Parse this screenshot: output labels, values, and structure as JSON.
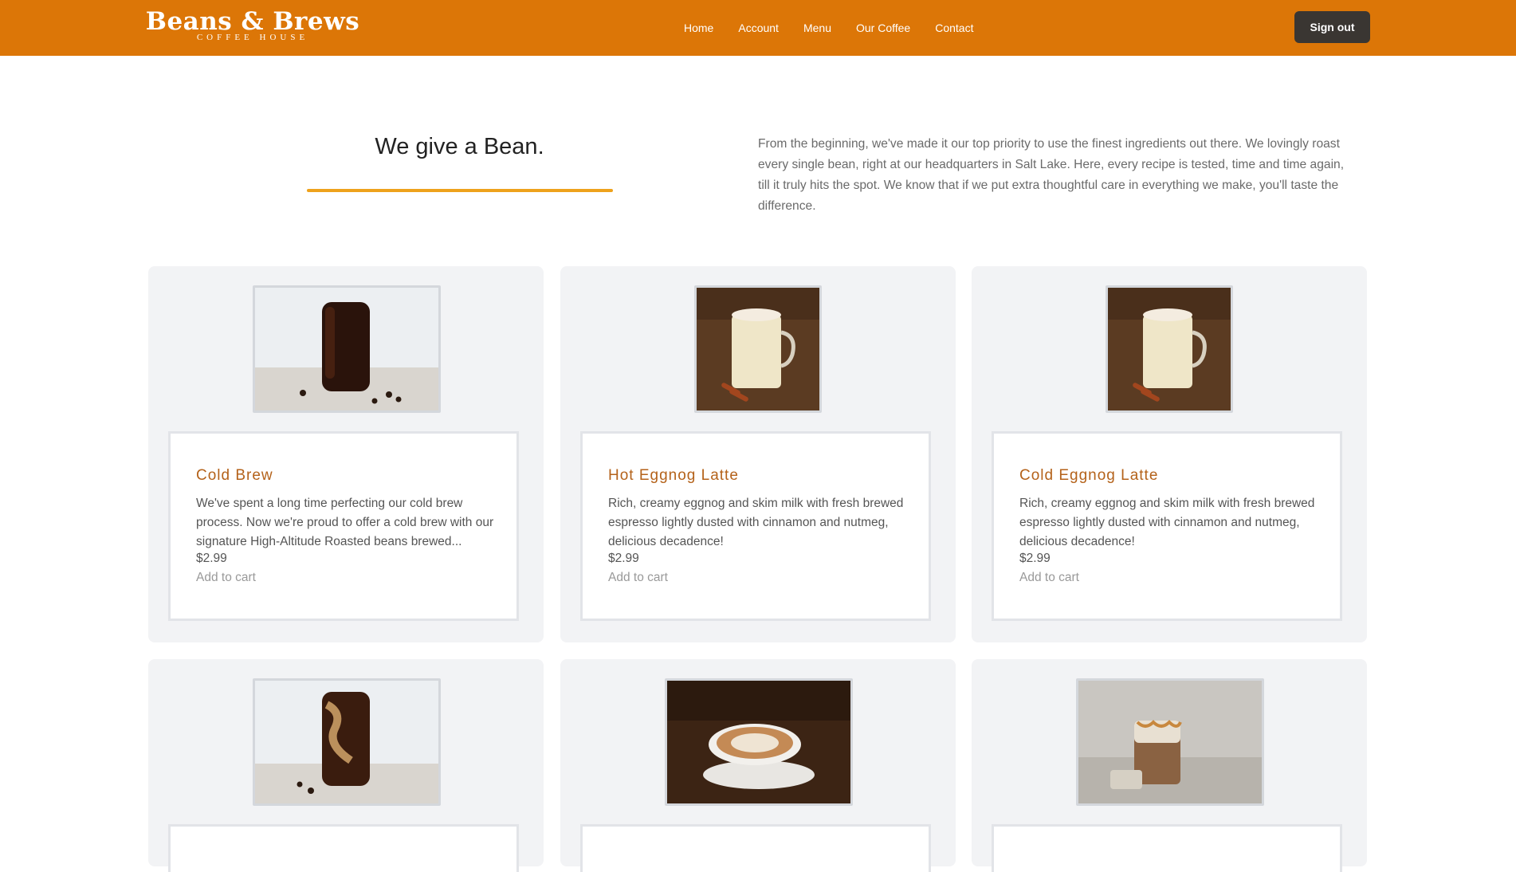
{
  "header": {
    "logo_main": "Beans & Brews",
    "logo_sub": "COFFEE HOUSE",
    "nav": [
      "Home",
      "Account",
      "Menu",
      "Our Coffee",
      "Contact"
    ],
    "signout_label": "Sign out",
    "bar_color": "#dc7607"
  },
  "intro": {
    "title": "We give a Bean.",
    "text": "From the beginning, we've made it our top priority to use the finest ingredients out there. We lovingly roast every single bean, right at our headquarters in Salt Lake. Here, every recipe is tested, time and time again, till it truly hits the spot. We know that if we put extra thoughtful care in everything we make, you'll taste the difference.",
    "accent_color": "#eea21c"
  },
  "cards": [
    {
      "title": "Cold Brew",
      "desc": "We've spent a long time perfecting our cold brew process. Now we're proud to offer a cold brew with our signature High-Altitude Roasted beans brewed...",
      "price": "$2.99",
      "cart": "Add to cart",
      "image": "cold-brew-photo"
    },
    {
      "title": "Hot Eggnog Latte",
      "desc": "Rich, creamy eggnog and skim milk with fresh brewed espresso lightly dusted with cinnamon and nutmeg, delicious decadence!",
      "price": "$2.99",
      "cart": "Add to cart",
      "image": "hot-eggnog-latte-photo"
    },
    {
      "title": "Cold Eggnog Latte",
      "desc": "Rich, creamy eggnog and skim milk with fresh brewed espresso lightly dusted with cinnamon and nutmeg, delicious decadence!",
      "price": "$2.99",
      "cart": "Add to cart",
      "image": "cold-eggnog-latte-photo"
    },
    {
      "image": "iced-coffee-photo"
    },
    {
      "image": "cappuccino-photo"
    },
    {
      "image": "caramel-macchiato-photo"
    }
  ]
}
